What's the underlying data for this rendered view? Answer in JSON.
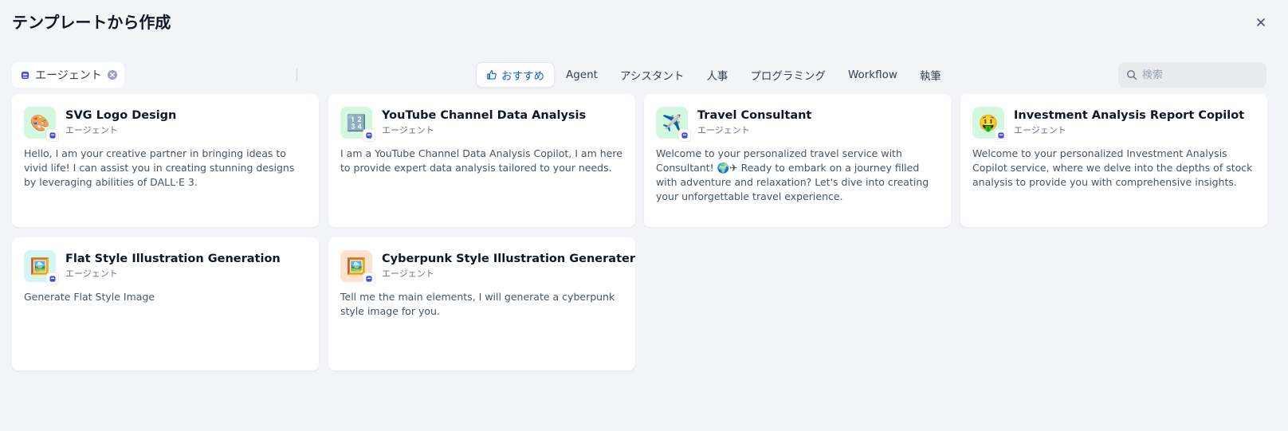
{
  "header": {
    "title": "テンプレートから作成",
    "close_icon": "close-icon"
  },
  "filter": {
    "label": "エージェント",
    "icon": "agent-bot-icon",
    "clear_icon": "clear-circle-icon"
  },
  "tabs": [
    {
      "label": "おすすめ",
      "icon": "thumbs-up-icon",
      "active": true
    },
    {
      "label": "Agent",
      "active": false
    },
    {
      "label": "アシスタント",
      "active": false
    },
    {
      "label": "人事",
      "active": false
    },
    {
      "label": "プログラミング",
      "active": false
    },
    {
      "label": "Workflow",
      "active": false
    },
    {
      "label": "執筆",
      "active": false
    }
  ],
  "search": {
    "placeholder": "検索",
    "icon": "search-icon"
  },
  "cards": [
    {
      "title": "SVG Logo Design",
      "type": "エージェント",
      "emoji": "🎨",
      "icon_bg": "#d3f8df",
      "description": "Hello, I am your creative partner in bringing ideas to vivid life! I can assist you in creating stunning designs by leveraging abilities of DALL·E 3."
    },
    {
      "title": "YouTube Channel Data Analysis",
      "type": "エージェント",
      "emoji": "🔢",
      "icon_bg": "#d3f8df",
      "description": "I am a YouTube Channel Data Analysis Copilot, I am here to provide expert data analysis tailored to your needs."
    },
    {
      "title": "Travel Consultant",
      "type": "エージェント",
      "emoji": "✈️",
      "icon_bg": "#d3f8df",
      "description": "Welcome to your personalized travel service with Consultant! 🌍✈ Ready to embark on a journey filled with adventure and relaxation? Let's dive into creating your unforgettable travel experience."
    },
    {
      "title": "Investment Analysis Report Copilot",
      "type": "エージェント",
      "emoji": "🤑",
      "icon_bg": "#d3f8df",
      "description": "Welcome to your personalized Investment Analysis Copilot service, where we delve into the depths of stock analysis to provide you with comprehensive insights."
    },
    {
      "title": "Flat Style Illustration Generation",
      "type": "エージェント",
      "emoji": "🖼️",
      "icon_bg": "#d5f5f6",
      "description": "Generate Flat Style Image"
    },
    {
      "title": "Cyberpunk Style Illustration Generater",
      "type": "エージェント",
      "emoji": "🖼️",
      "icon_bg": "#fde2d0",
      "description": "Tell me the main elements, I will generate a cyberpunk style image for you."
    }
  ],
  "colors": {
    "accent": "#155eef",
    "background": "#f2f4f7",
    "badge_blue": "#444ce7"
  }
}
